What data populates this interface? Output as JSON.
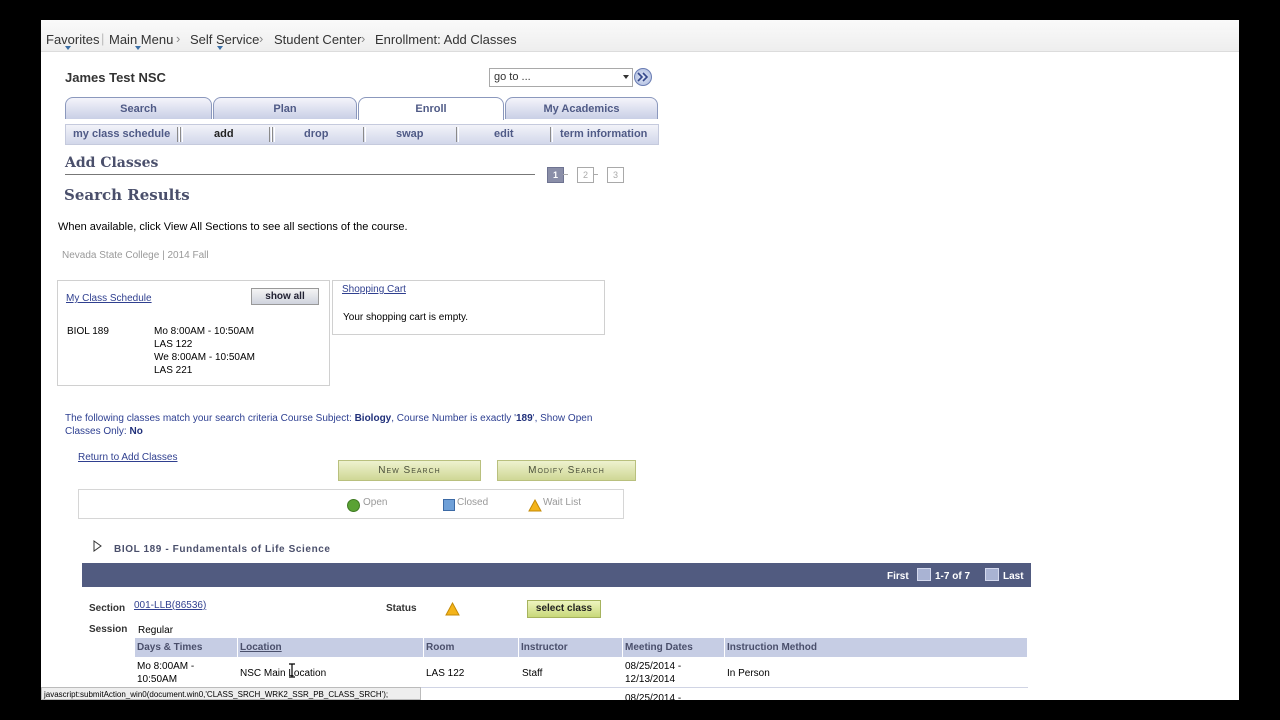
{
  "breadcrumb": {
    "favorites": "Favorites",
    "main_menu": "Main Menu",
    "self_service": "Self Service",
    "student_center": "Student Center",
    "current": "Enrollment: Add Classes"
  },
  "header": {
    "user_name": "James Test NSC",
    "goto_value": "go to ..."
  },
  "tabs": [
    {
      "label": "Search"
    },
    {
      "label": "Plan"
    },
    {
      "label": "Enroll",
      "active": true
    },
    {
      "label": "My Academics"
    }
  ],
  "subtabs": [
    "my class schedule",
    "add",
    "drop",
    "swap",
    "edit",
    "term information"
  ],
  "page": {
    "title": "Add Classes",
    "steps": [
      "1",
      "2",
      "3"
    ],
    "subtitle": "Search Results",
    "instruction": "When available, click View All Sections to see all sections of the course.",
    "term": "Nevada State College | 2014 Fall"
  },
  "schedule_box": {
    "title": "My Class Schedule",
    "show_all": "show all",
    "course": "BIOL 189",
    "lines": [
      "Mo 8:00AM - 10:50AM",
      "LAS 122",
      "We 8:00AM - 10:50AM",
      "LAS 221"
    ]
  },
  "cart_box": {
    "title": "Shopping Cart",
    "empty_text": "Your shopping cart is empty."
  },
  "criteria": {
    "prefix": "The following classes match your search criteria Course Subject:",
    "subject": "Biology",
    "mid": ",  Course Number is exactly '",
    "number": "189",
    "mid2": "',  Show Open Classes Only:",
    "open_only": "No"
  },
  "return_link": "Return to Add Classes",
  "buttons": {
    "new_search": "New Search",
    "modify_search": "Modify Search"
  },
  "legend": {
    "open": "Open",
    "closed": "Closed",
    "wait": "Wait List"
  },
  "course": {
    "title": "BIOL  189 - Fundamentals of Life Science",
    "nav": {
      "first": "First",
      "range": "1-7 of 7",
      "last": "Last"
    },
    "section_label": "Section",
    "section_value": "001-LLB(86536)",
    "status_label": "Status",
    "select_label": "select class",
    "session_label": "Session",
    "session_value": "Regular",
    "columns": [
      "Days & Times",
      "Location",
      "Room",
      "Instructor",
      "Meeting Dates",
      "Instruction Method"
    ],
    "rows": [
      {
        "days_times": "Mo 8:00AM - 10:50AM",
        "location": "NSC Main Location",
        "room": "LAS 122",
        "instructor": "Staff",
        "dates": "08/25/2014 - 12/13/2014",
        "method": "In Person"
      },
      {
        "dates": "08/25/2014 -"
      }
    ]
  },
  "status_bar": "javascript:submitAction_win0(document.win0,'CLASS_SRCH_WRK2_SSR_PB_CLASS_SRCH');",
  "colors": {
    "nav_bar": "#515b80",
    "header_row": "#c6cde4",
    "link": "#2f3f8f"
  }
}
